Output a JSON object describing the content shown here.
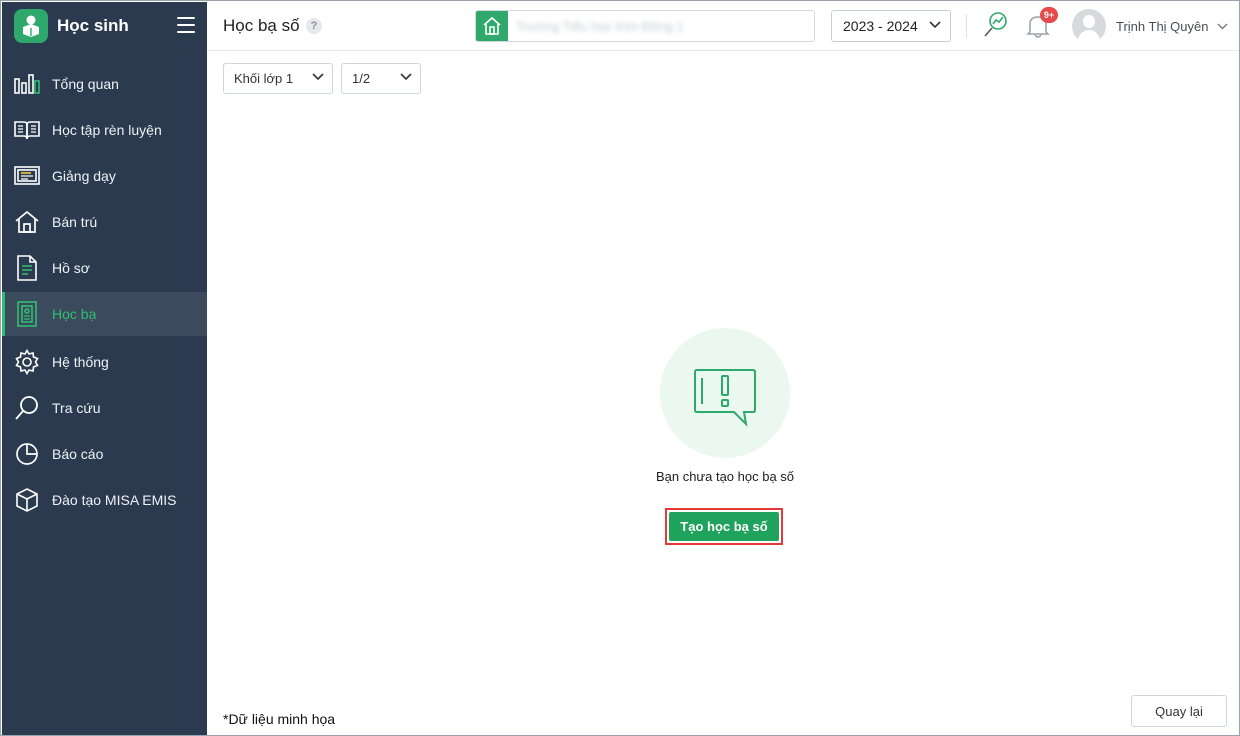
{
  "app": {
    "brand": "Học sinh",
    "page_title": "Học bạ số",
    "colors": {
      "sidebar_bg": "#2b3a4e",
      "accent": "#2fbf70",
      "primary_button": "#1fa25b",
      "highlight_outline": "#e53935",
      "badge": "#e64a4a"
    }
  },
  "sidebar": {
    "items": [
      {
        "label": "Tổng quan",
        "icon": "bar-chart-icon",
        "active": false
      },
      {
        "label": "Học tập rèn luyện",
        "icon": "open-book-icon",
        "active": false
      },
      {
        "label": "Giảng dạy",
        "icon": "board-icon",
        "active": false
      },
      {
        "label": "Bán trú",
        "icon": "house-icon",
        "active": false
      },
      {
        "label": "Hồ sơ",
        "icon": "document-icon",
        "active": false
      },
      {
        "label": "Học bạ",
        "icon": "record-book-icon",
        "active": true
      },
      {
        "label": "Hệ thống",
        "icon": "gear-icon",
        "active": false
      },
      {
        "label": "Tra cứu",
        "icon": "magnifier-icon",
        "active": false
      },
      {
        "label": "Báo cáo",
        "icon": "pie-chart-icon",
        "active": false
      },
      {
        "label": "Đào tạo MISA EMIS",
        "icon": "cube-icon",
        "active": false
      }
    ]
  },
  "header": {
    "school_placeholder": "Trường Tiểu học Kim Đồng 1",
    "school_year": "2023 - 2024",
    "notification_badge": "9+",
    "user_name": "Trịnh Thị Quyên"
  },
  "filters": {
    "grade": "Khối lớp 1",
    "class": "1/2"
  },
  "empty_state": {
    "message": "Bạn chưa tạo học bạ số",
    "create_button": "Tạo học bạ số",
    "icon": "speech-bubble-exclamation-icon"
  },
  "footer": {
    "note": "*Dữ liệu minh họa",
    "back_button": "Quay lại"
  }
}
